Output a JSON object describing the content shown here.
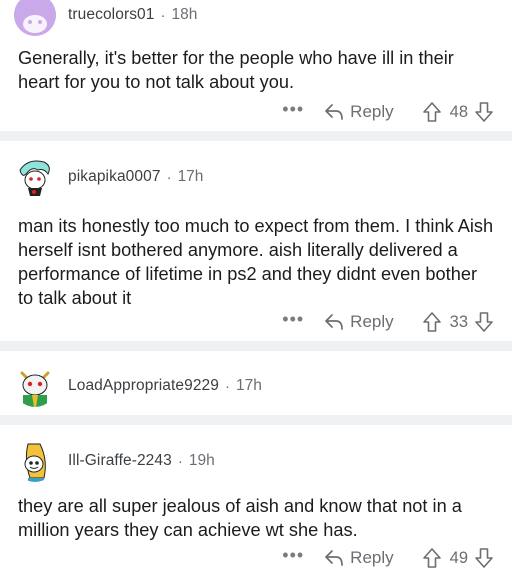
{
  "comments": [
    {
      "username": "truecolors01",
      "time": "18h",
      "body": "Generally, it's better for the people who have ill in their heart for you to not talk about you.",
      "reply_label": "Reply",
      "votes": "48",
      "more_label": "•••"
    },
    {
      "username": "pikapika0007",
      "time": "17h",
      "body": "man its honestly too much to expect from them. I think Aish herself isnt bothered anymore. aish literally delivered a performance of lifetime in ps2 and they didnt even bother to talk about it",
      "reply_label": "Reply",
      "votes": "33",
      "more_label": "•••"
    },
    {
      "username": "LoadAppropriate9229",
      "time": "17h"
    },
    {
      "username": "Ill-Giraffe-2243",
      "time": "19h",
      "body": "they are all super jealous of aish and know that not in a million years they can achieve wt she has.",
      "reply_label": "Reply",
      "votes": "49",
      "more_label": "•••"
    }
  ],
  "separator_label": "·",
  "colors": {
    "separator": "#eef0f2",
    "meta": "#6b6f74",
    "text": "#1c1c1c"
  },
  "icons": {
    "reply": "reply-arrow-icon",
    "upvote": "upvote-arrow-icon",
    "downvote": "downvote-arrow-icon",
    "more": "more-dots-icon"
  }
}
